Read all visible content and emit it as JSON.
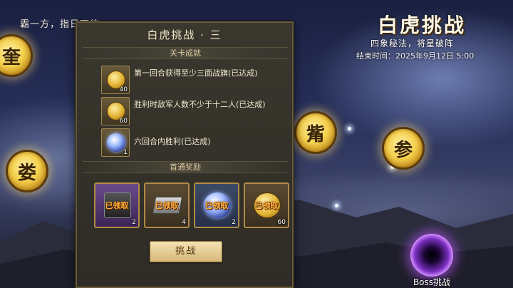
{
  "motto": "霸一方，指日可待",
  "event": {
    "title": "白虎挑战",
    "subtitle": "四象秘法，将星破阵",
    "end_time": "结束时间：2025年9月12日 5:00"
  },
  "constellations": [
    "奎",
    "娄",
    "觜",
    "参"
  ],
  "boss": {
    "label": "Boss挑战",
    "icon": "vortex-portal-icon"
  },
  "panel": {
    "title": "白虎挑战 · 三",
    "achievements_header": "关卡成就",
    "achievements": [
      {
        "icon": "gold-coin-icon",
        "qty": "40",
        "text": "第一回合获得至少三面战旗(已达成)"
      },
      {
        "icon": "gold-coin-icon",
        "qty": "60",
        "text": "胜利时敌军人数不少于十二人(已达成)"
      },
      {
        "icon": "star-orb-icon",
        "qty": "1",
        "text": "六回合内胜利(已达成)"
      }
    ],
    "rewards_header": "首通奖励",
    "rewards": [
      {
        "icon": "mystery-box-icon",
        "qty": "2",
        "status": "已领取"
      },
      {
        "icon": "silver-ingot-icon",
        "qty": "4",
        "status": "已领取"
      },
      {
        "icon": "star-orb-icon",
        "qty": "2",
        "status": "已领取"
      },
      {
        "icon": "gold-coin-icon",
        "qty": "60",
        "status": "已领取"
      }
    ],
    "challenge_label": "挑战"
  },
  "colors": {
    "accent_gold": "#f4cf4c",
    "claimed_orange": "#ffb23a",
    "panel_bg": "#2e2c25"
  }
}
